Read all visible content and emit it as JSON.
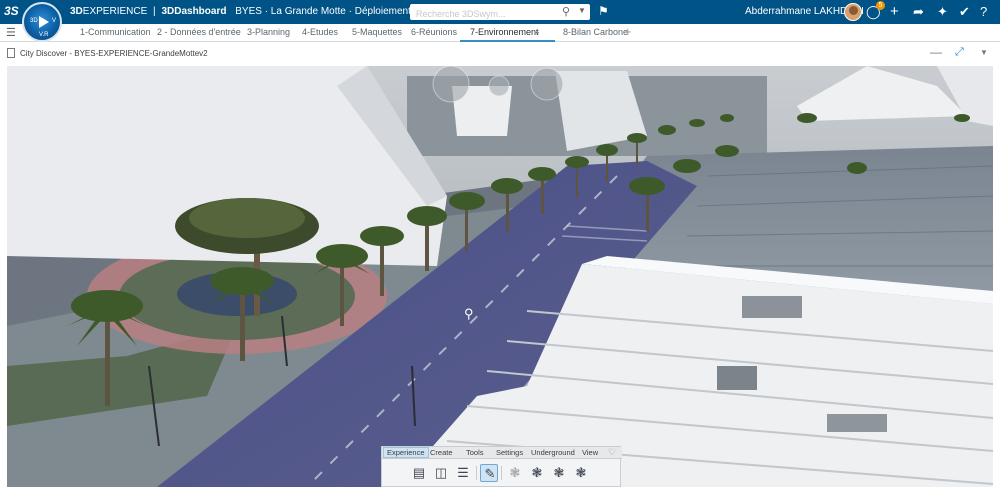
{
  "topbar": {
    "ds_logo": "3S",
    "compass_labels": [
      "3D",
      "V",
      "V.R"
    ],
    "brand_prefix": "3D",
    "brand_experience": "EXPERIENCE",
    "brand_sep": "|",
    "app_name": "3DDashboard",
    "context": "BYES · La Grande Motte · Déploiement",
    "search_placeholder": "Recherche 3DSwym...",
    "user_name": "Abderrahmane LAKHDARI",
    "notification_count": "5",
    "icons": [
      "tag-icon",
      "notification-icon",
      "add-icon",
      "share-icon",
      "network-icon",
      "tools-icon"
    ]
  },
  "tabs": [
    {
      "label": "1-Communication",
      "active": false
    },
    {
      "label": "2 - Données d'entrée",
      "active": false
    },
    {
      "label": "3-Planning",
      "active": false
    },
    {
      "label": "4-Etudes",
      "active": false
    },
    {
      "label": "5-Maquettes",
      "active": false
    },
    {
      "label": "6-Réunions",
      "active": false
    },
    {
      "label": "7-Environnement",
      "active": true
    },
    {
      "label": "8-Bilan Carbone",
      "active": false
    }
  ],
  "widget": {
    "title": "City Discover - BYES-EXPERIENCE-GrandeMottev2"
  },
  "actionbar": {
    "tabs": [
      {
        "label": "Experience",
        "active": true
      },
      {
        "label": "Create",
        "active": false
      },
      {
        "label": "Tools",
        "active": false
      },
      {
        "label": "Settings",
        "active": false
      },
      {
        "label": "Underground",
        "active": false
      },
      {
        "label": "View",
        "active": false
      }
    ],
    "tools": [
      "document-icon",
      "image-icon",
      "list-icon",
      "pencil-icon",
      "molecule-icon",
      "molecule-icon",
      "molecule-icon",
      "molecule-icon"
    ]
  },
  "colors": {
    "topbar": "#005386",
    "accent": "#368ec4",
    "notification": "#f39200"
  }
}
